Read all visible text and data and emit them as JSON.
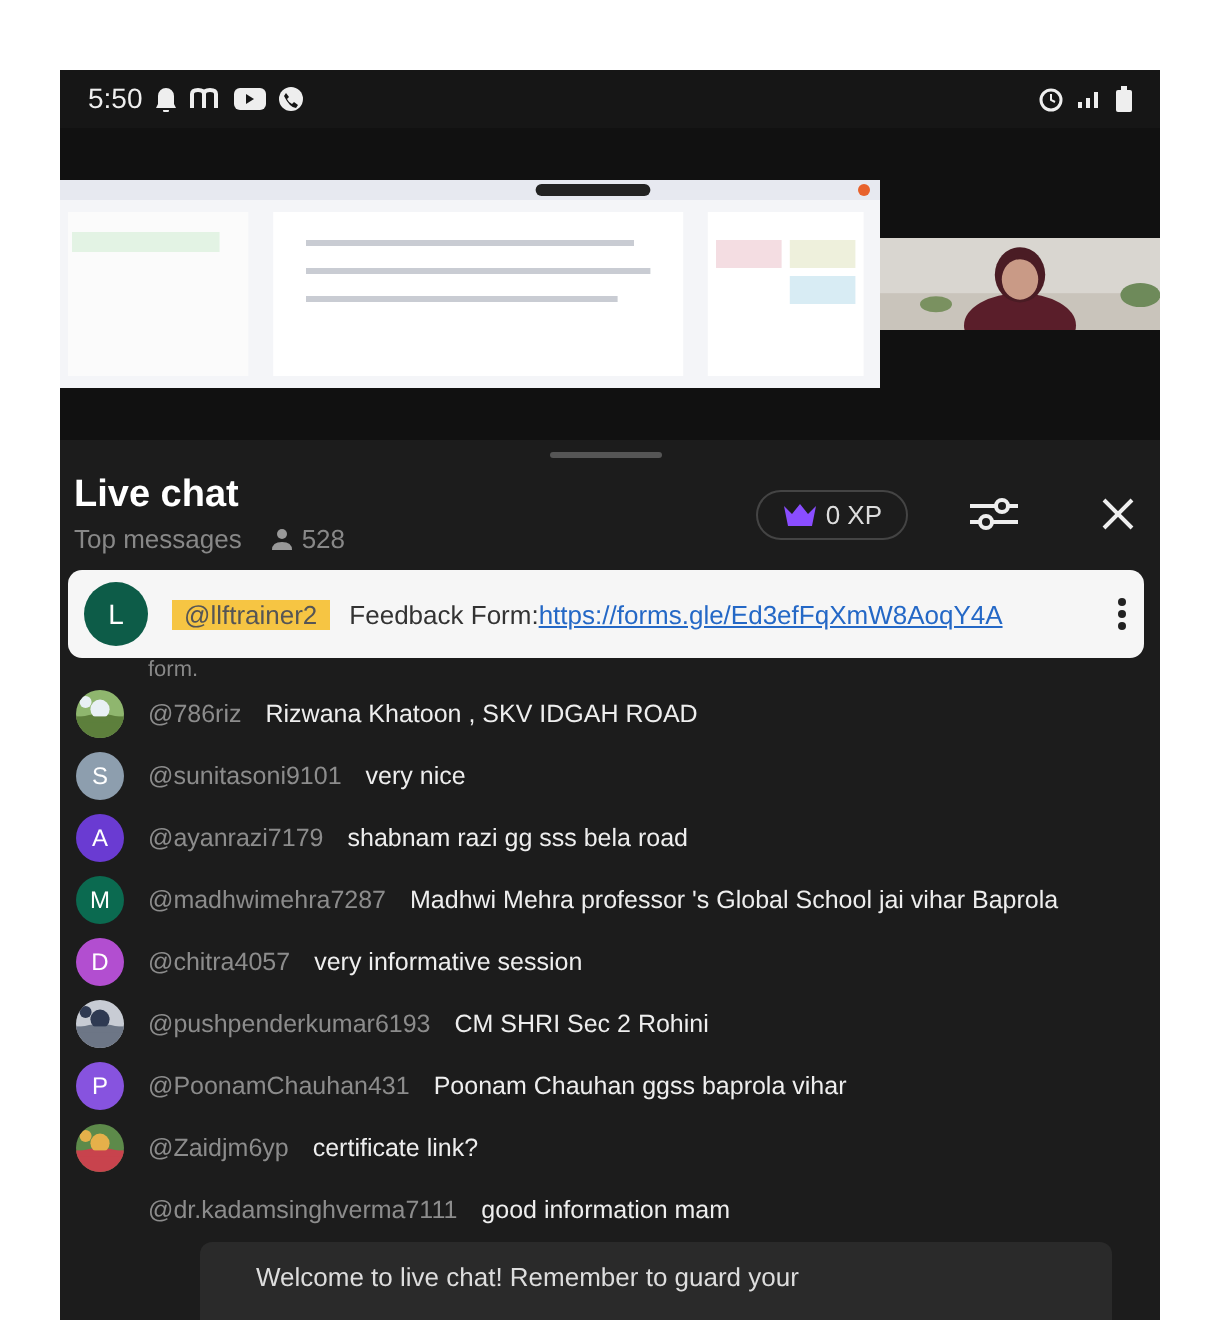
{
  "status_bar": {
    "time": "5:50"
  },
  "chat": {
    "title": "Live chat",
    "subtitle": "Top messages",
    "viewers": "528",
    "xp": "0 XP",
    "pinned": {
      "avatar": "L",
      "color": "#0d5c48",
      "author": "@llftrainer2",
      "text": "Feedback Form:",
      "link": "https://forms.gle/Ed3efFqXmW8AoqY4A"
    },
    "overflow_text": "form.",
    "messages": [
      {
        "author": "@786riz",
        "text": "Rizwana Khatoon , SKV IDGAH ROAD"
      },
      {
        "avatar": {
          "kind": "letter",
          "letter": "S",
          "color": "#8d9eae"
        },
        "author": "@sunitasoni9101",
        "text": "very nice"
      },
      {
        "avatar": {
          "kind": "letter",
          "letter": "A",
          "color": "#6a3bd2"
        },
        "author": "@ayanrazi7179",
        "text": "shabnam razi gg sss bela road"
      },
      {
        "avatar": {
          "kind": "letter",
          "letter": "M",
          "color": "#0b6a50"
        },
        "author": "@madhwimehra7287",
        "text": "Madhwi Mehra professor 's Global School jai vihar Baprola"
      },
      {
        "avatar": {
          "kind": "letter",
          "letter": "D",
          "color": "#b24ed0"
        },
        "author": "@chitra4057",
        "text": "very informative session"
      },
      {
        "author": "@pushpenderkumar6193",
        "text": "CM SHRI Sec 2 Rohini"
      },
      {
        "avatar": {
          "kind": "letter",
          "letter": "P",
          "color": "#8753df"
        },
        "author": "@PoonamChauhan431",
        "text": "Poonam Chauhan ggss baprola vihar"
      },
      {
        "author": "@Zaidjm6yp",
        "text": "certificate link?"
      },
      {
        "avatar": {
          "kind": "none"
        },
        "author": "@dr.kadamsinghverma7111",
        "text": "good information mam"
      }
    ],
    "welcome": "Welcome to live chat! Remember to guard your"
  }
}
